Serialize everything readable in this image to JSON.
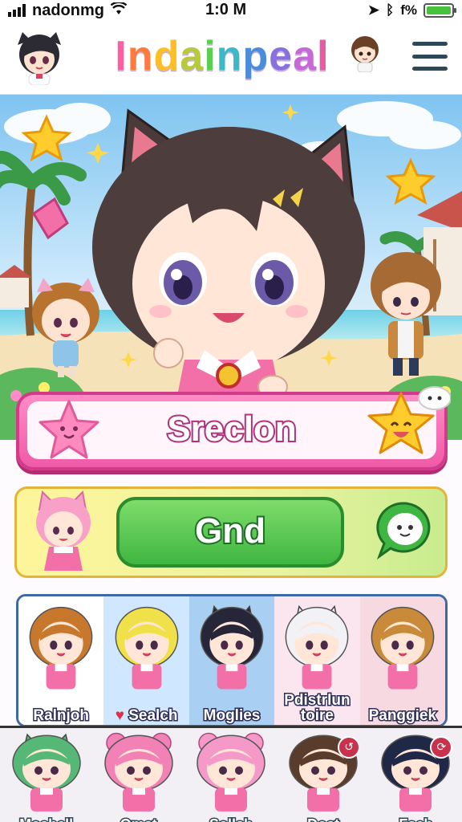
{
  "status_bar": {
    "carrier": "nadonmg",
    "time": "1:0 M",
    "battery_text": "f%",
    "battery_level": 1.0
  },
  "header": {
    "title_letters": [
      "I",
      "n",
      "d",
      "a",
      "i",
      "n",
      "p",
      "e",
      "a",
      "l"
    ],
    "title_colors": [
      "#ff5fa2",
      "#ff7a3c",
      "#ffbe22",
      "#b8c93a",
      "#5ccf53",
      "#3cb9c9",
      "#4a8ddc",
      "#8a6fe0",
      "#c768d8",
      "#e95aa4"
    ]
  },
  "hero": {
    "accent": "#f36fa8"
  },
  "primary_button": {
    "label": "Sreclon"
  },
  "secondary_button": {
    "label": "Gnd"
  },
  "characters": [
    {
      "name": "Ralnjoh",
      "hair": "#c8782c",
      "bg": "#ffffff"
    },
    {
      "name": "Sealch",
      "hair": "#f0e04a",
      "bg": "#cfe7ff",
      "prefix": "♥"
    },
    {
      "name": "Moglies",
      "hair": "#262638",
      "bg": "#a9d0f2"
    },
    {
      "name": "Pdistrlun toire",
      "hair": "#f2f2f6",
      "bg": "#fbe6ef"
    },
    {
      "name": "Panggiek",
      "hair": "#c98a3a",
      "bg": "#f7d9e2"
    }
  ],
  "bottom_nav": [
    {
      "label": "Moshell",
      "hair": "#56b877",
      "badge": ""
    },
    {
      "label": "Omst",
      "hair": "#f281b6",
      "badge": ""
    },
    {
      "label": "Sollsh",
      "hair": "#f59ac8",
      "badge": ""
    },
    {
      "label": "Dost",
      "hair": "#5a3c2c",
      "badge": "↺"
    },
    {
      "label": "Fsch",
      "hair": "#1f2846",
      "badge": "⟳"
    }
  ],
  "colors": {
    "pink": "#f05aa7",
    "green": "#3fb641",
    "navy": "#2d4858"
  }
}
